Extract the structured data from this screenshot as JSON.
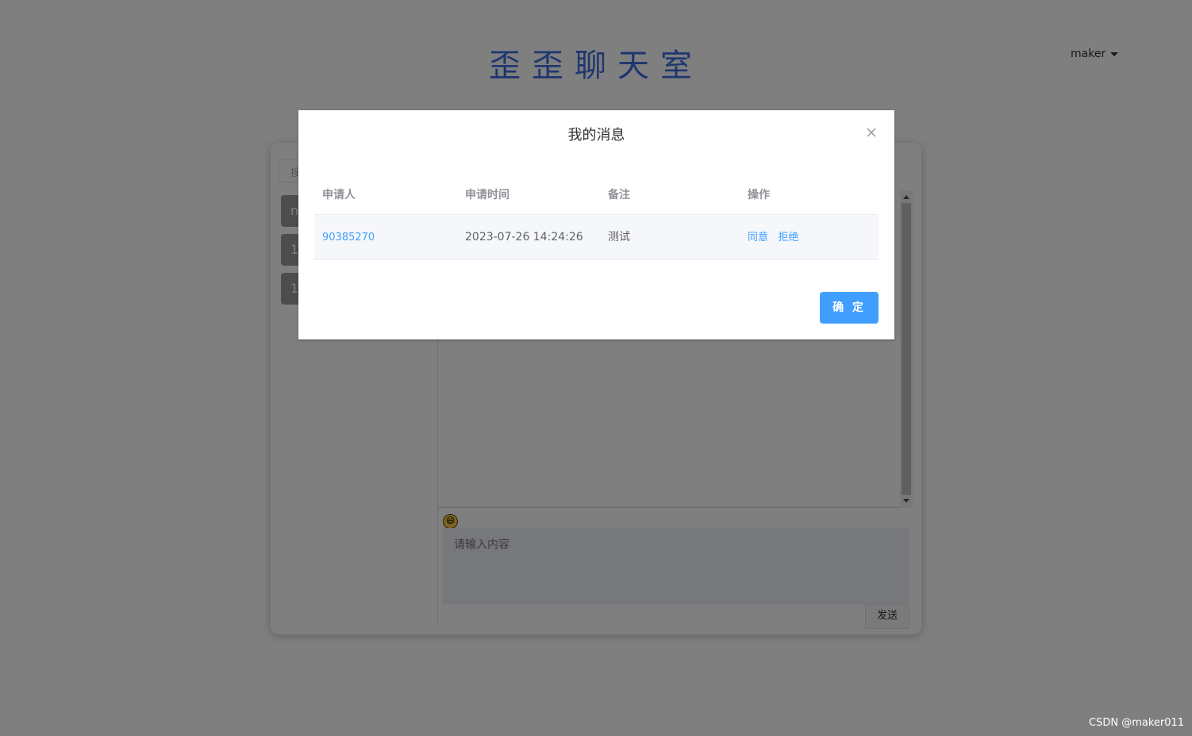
{
  "app": {
    "title": "歪歪聊天室",
    "user": "maker"
  },
  "sidebar": {
    "search_placeholder": "搜",
    "contacts": [
      {
        "label": "n"
      },
      {
        "label": "1"
      },
      {
        "label": "1"
      }
    ]
  },
  "composer": {
    "placeholder": "请输入内容",
    "emoji": "😄",
    "send_label": "发送"
  },
  "dialog": {
    "title": "我的消息",
    "columns": [
      "申请人",
      "申请时间",
      "备注",
      "操作"
    ],
    "rows": [
      {
        "applicant": "90385270",
        "time": "2023-07-26 14:24:26",
        "remark": "测试",
        "actions": [
          "同意",
          "拒绝"
        ]
      }
    ],
    "confirm_label": "确 定"
  },
  "watermark": "CSDN @maker011",
  "colors": {
    "accent": "#409eff",
    "title": "#3d6fe0",
    "overlay": "rgba(0,0,0,0.5)"
  }
}
